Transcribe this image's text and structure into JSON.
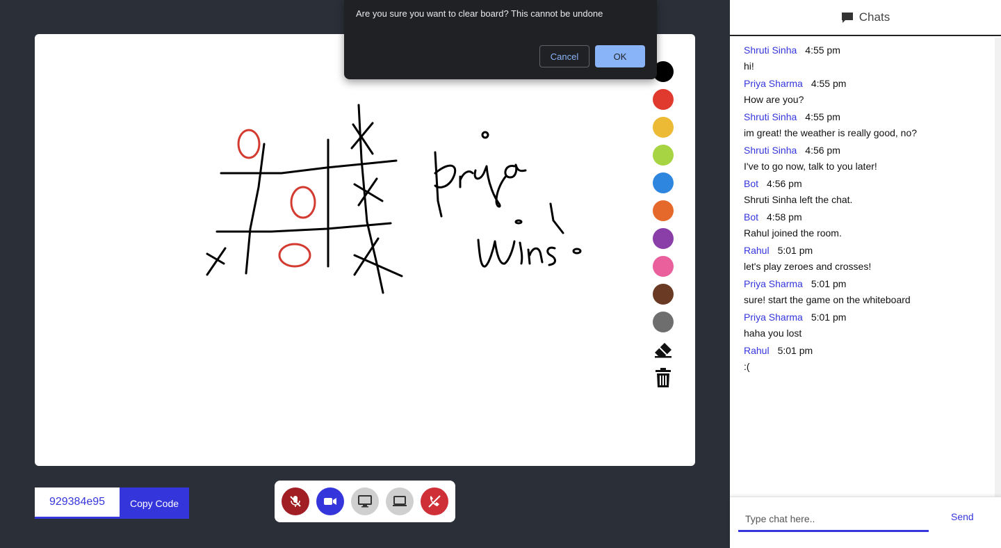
{
  "dialog": {
    "message": "Are you sure you want to clear board? This cannot be undone",
    "cancel_label": "Cancel",
    "ok_label": "OK"
  },
  "palette": {
    "colors": [
      "#000000",
      "#e03a2f",
      "#ecba34",
      "#a6d442",
      "#2e86de",
      "#e5692a",
      "#8a3ea8",
      "#e9609d",
      "#6b3a24",
      "#6e6e6e"
    ]
  },
  "room": {
    "code": "929384e95",
    "copy_label": "Copy Code"
  },
  "chat": {
    "title": "Chats",
    "input_placeholder": "Type chat here..",
    "send_label": "Send",
    "messages": [
      {
        "author": "Shruti Sinha",
        "time": "4:55 pm",
        "text": "hi!"
      },
      {
        "author": "Priya Sharma",
        "time": "4:55 pm",
        "text": "How are you?"
      },
      {
        "author": "Shruti Sinha",
        "time": "4:55 pm",
        "text": "im great! the weather is really good, no?"
      },
      {
        "author": "Shruti Sinha",
        "time": "4:56 pm",
        "text": "I've to go now, talk to you later!"
      },
      {
        "author": "Bot",
        "time": "4:56 pm",
        "text": "Shruti Sinha left the chat."
      },
      {
        "author": "Bot",
        "time": "4:58 pm",
        "text": "Rahul joined the room."
      },
      {
        "author": "Rahul",
        "time": "5:01 pm",
        "text": "let's play zeroes and crosses!"
      },
      {
        "author": "Priya Sharma",
        "time": "5:01 pm",
        "text": "sure! start the game on the whiteboard"
      },
      {
        "author": "Priya Sharma",
        "time": "5:01 pm",
        "text": "haha you lost"
      },
      {
        "author": "Rahul",
        "time": "5:01 pm",
        "text": ":("
      }
    ]
  }
}
